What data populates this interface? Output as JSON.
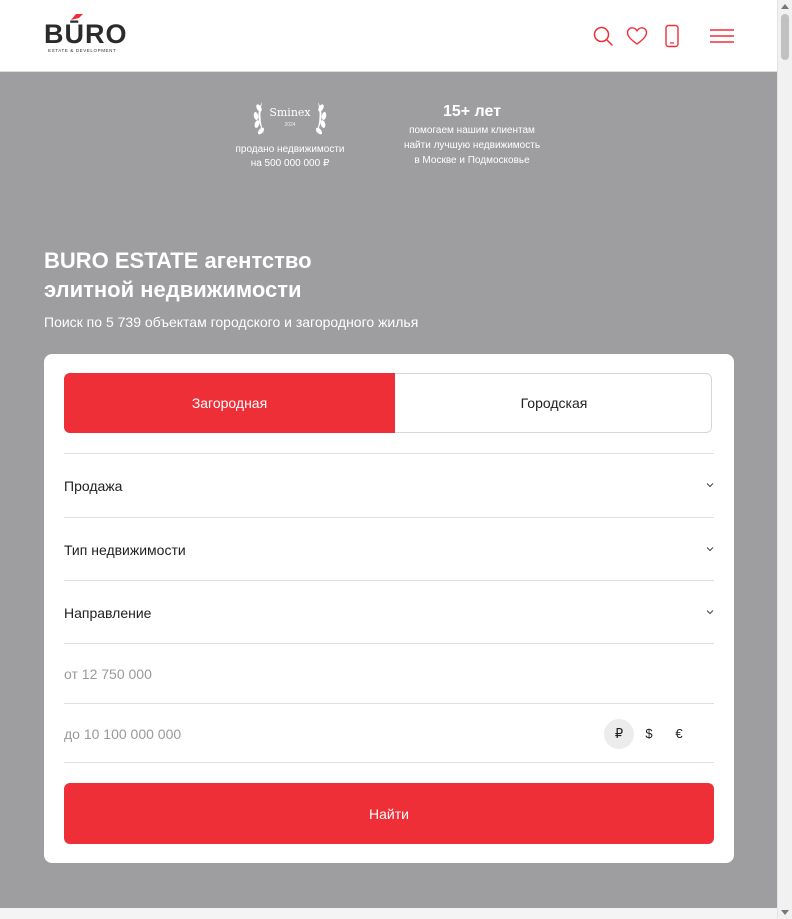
{
  "header": {
    "logo_text": "BŪRO",
    "logo_sub": "ESTATE & DEVELOPMENT",
    "icons": [
      "search-icon",
      "heart-icon",
      "phone-icon",
      "menu-icon"
    ],
    "accent": "#ef2f37"
  },
  "badges": {
    "award": {
      "name": "Sminex",
      "year": "2024",
      "text_line1": "продано недвижимости",
      "text_line2": "на 500 000 000 ₽"
    },
    "experience": {
      "title": "15+ лет",
      "line1": "помогаем нашим клиентам",
      "line2": "найти лучшую недвижимость",
      "line3": "в Москве и Подмосковье"
    }
  },
  "hero": {
    "title_line1": "BURO ESTATE агентство",
    "title_line2": "элитной недвижимости",
    "subtitle": "Поиск по 5 739 объектам городского и загородного жилья"
  },
  "search": {
    "tabs": [
      {
        "label": "Загородная",
        "active": true
      },
      {
        "label": "Городская",
        "active": false
      }
    ],
    "selects": [
      {
        "label": "Продажа"
      },
      {
        "label": "Тип недвижимости"
      },
      {
        "label": "Направление"
      }
    ],
    "price_from_placeholder": "от 12 750 000",
    "price_to_placeholder": "до 10 100 000 000",
    "currencies": [
      {
        "symbol": "₽",
        "active": true
      },
      {
        "symbol": "$",
        "active": false
      },
      {
        "symbol": "€",
        "active": false
      }
    ],
    "submit_label": "Найти"
  }
}
